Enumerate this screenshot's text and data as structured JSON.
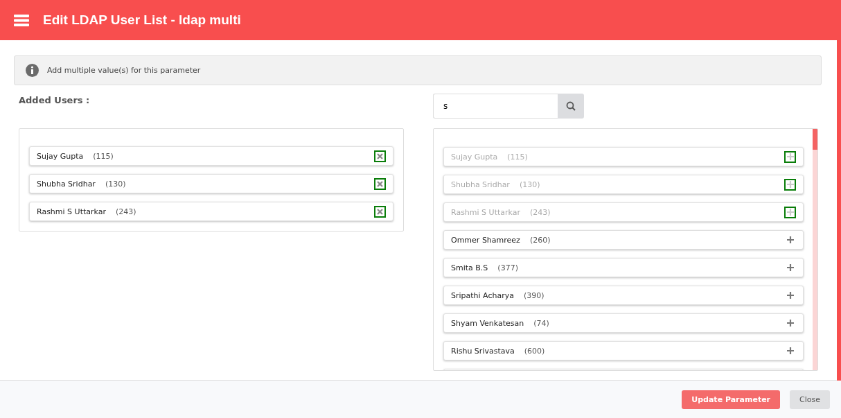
{
  "window": {
    "title": "Edit LDAP User List - ldap multi"
  },
  "info": {
    "text": "Add multiple value(s) for this parameter"
  },
  "added_users": {
    "label": "Added Users :",
    "items": [
      {
        "name": "Sujay Gupta",
        "id": "(115)"
      },
      {
        "name": "Shubha Sridhar",
        "id": "(130)"
      },
      {
        "name": "Rashmi S Uttarkar",
        "id": "(243)"
      }
    ]
  },
  "search": {
    "value": "s"
  },
  "results": [
    {
      "name": "Sujay Gupta",
      "id": "(115)",
      "added": true
    },
    {
      "name": "Shubha Sridhar",
      "id": "(130)",
      "added": true
    },
    {
      "name": "Rashmi S Uttarkar",
      "id": "(243)",
      "added": true
    },
    {
      "name": "Ommer Shamreez",
      "id": "(260)",
      "added": false
    },
    {
      "name": "Smita B.S",
      "id": "(377)",
      "added": false
    },
    {
      "name": "Sripathi Acharya",
      "id": "(390)",
      "added": false
    },
    {
      "name": "Shyam Venkatesan",
      "id": "(74)",
      "added": false
    },
    {
      "name": "Rishu Srivastava",
      "id": "(600)",
      "added": false
    }
  ],
  "buttons": [
    {
      "label": "Update Parameter",
      "kind": "primary"
    },
    {
      "label": "Close",
      "kind": "secondary"
    }
  ]
}
